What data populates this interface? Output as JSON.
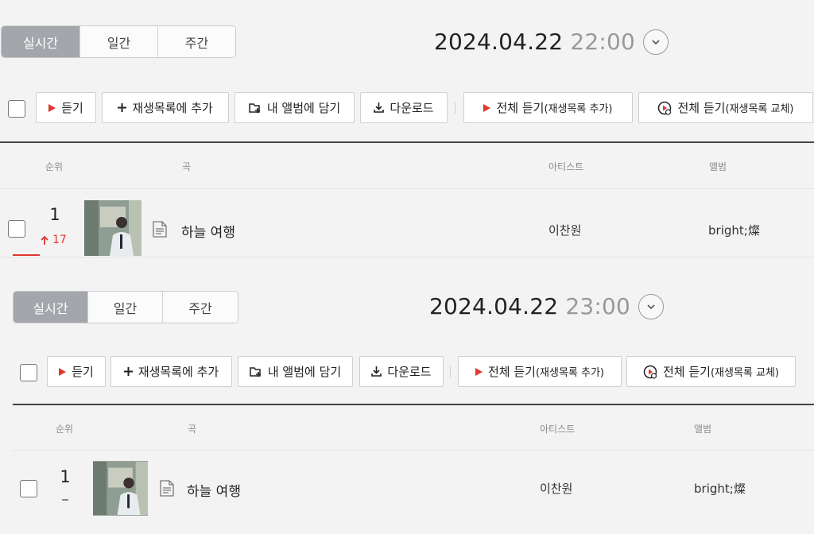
{
  "colors": {
    "accent": "#e2372e",
    "active_tab": "#a3a6ab",
    "header_line": "#444444"
  },
  "charts": [
    {
      "tabs": [
        {
          "label": "실시간",
          "active": true
        },
        {
          "label": "일간",
          "active": false
        },
        {
          "label": "주간",
          "active": false
        }
      ],
      "date": "2024.04.22",
      "time": "22:00",
      "toolbar": {
        "listen": "듣기",
        "add_playlist": "재생목록에 추가",
        "my_album": "내 앨범에 담기",
        "download": "다운로드",
        "listen_all": "전체 듣기",
        "listen_all_note": "(재생목록 추가)",
        "listen_all_replace": "전체 듣기",
        "listen_all_replace_note": "(재생목록 교체)"
      },
      "headers": {
        "rank": "순위",
        "song": "곡",
        "artist": "아티스트",
        "album": "앨범"
      },
      "rows": [
        {
          "rank": "1",
          "change": "17",
          "change_dir": "up",
          "title": "하늘 여행",
          "artist": "이찬원",
          "album": "bright;燦"
        }
      ]
    },
    {
      "tabs": [
        {
          "label": "실시간",
          "active": true
        },
        {
          "label": "일간",
          "active": false
        },
        {
          "label": "주간",
          "active": false
        }
      ],
      "date": "2024.04.22",
      "time": "23:00",
      "toolbar": {
        "listen": "듣기",
        "add_playlist": "재생목록에 추가",
        "my_album": "내 앨범에 담기",
        "download": "다운로드",
        "listen_all": "전체 듣기",
        "listen_all_note": "(재생목록 추가)",
        "listen_all_replace": "전체 듣기",
        "listen_all_replace_note": "(재생목록 교체)"
      },
      "headers": {
        "rank": "순위",
        "song": "곡",
        "artist": "아티스트",
        "album": "앨범"
      },
      "rows": [
        {
          "rank": "1",
          "change": "",
          "change_dir": "same",
          "title": "하늘 여행",
          "artist": "이찬원",
          "album": "bright;燦"
        }
      ]
    }
  ]
}
